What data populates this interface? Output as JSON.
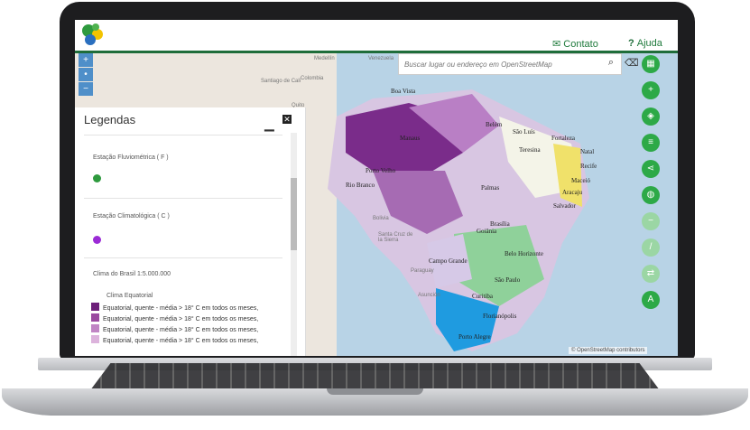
{
  "header": {
    "contact_label": "Contato",
    "help_label": "Ajuda",
    "help_glyph": "?"
  },
  "search": {
    "placeholder": "Buscar lugar ou endereço em OpenStreetMap"
  },
  "zoom": {
    "in": "+",
    "mid": "•",
    "out": "−"
  },
  "legend_panel": {
    "title": "Legendas",
    "sections": [
      {
        "label": "Estação Fluviométrica ( F )",
        "dot_color": "#2e9a3e"
      },
      {
        "label": "Estação Climatológica ( C )",
        "dot_color": "#9b2bd6"
      }
    ],
    "climate_title": "Clima do Brasil 1:5.000.000",
    "climate_group": "Clima Equatorial",
    "climate_rows": [
      {
        "text": "Equatorial, quente - média > 18° C em todos os meses,",
        "color": "#6d1f7a"
      },
      {
        "text": "Equatorial, quente - média > 18° C em todos os meses,",
        "color": "#9a4aa0"
      },
      {
        "text": "Equatorial, quente - média > 18° C em todos os meses,",
        "color": "#c085c4"
      },
      {
        "text": "Equatorial, quente - média > 18° C em todos os meses,",
        "color": "#dcb3dc"
      }
    ]
  },
  "map_labels": {
    "cities": [
      "Boa Vista",
      "Belém",
      "São Luís",
      "Fortaleza",
      "Teresina",
      "Natal",
      "Recife",
      "Maceió",
      "Aracaju",
      "Salvador",
      "Manaus",
      "Porto Velho",
      "Rio Branco",
      "Palmas",
      "Goiânia",
      "Brasília",
      "Campo Grande",
      "Belo Horizonte",
      "São Paulo",
      "Curitiba",
      "Florianópolis",
      "Porto Alegre"
    ],
    "background": [
      "Medellín",
      "Venezuela",
      "Colombia",
      "Santiago de Cali",
      "Quito",
      "Bolivia",
      "Santa Cruz de la Sierra",
      "Paraguay",
      "Asunción"
    ]
  },
  "attribution": "© OpenStreetMap contributors",
  "right_toolbar": [
    "map-icon",
    "plus-icon",
    "layers-icon",
    "list-icon",
    "share-icon",
    "globe-icon",
    "minus-icon",
    "ruler-icon",
    "swap-icon",
    "A"
  ]
}
